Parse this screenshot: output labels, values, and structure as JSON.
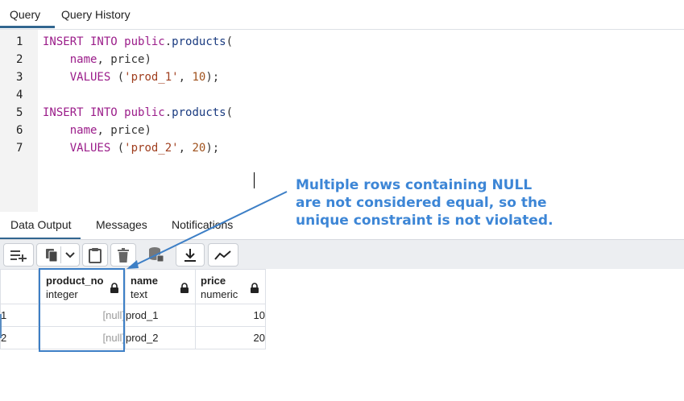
{
  "top_tabs": [
    {
      "label": "Query",
      "active": true
    },
    {
      "label": "Query History",
      "active": false
    }
  ],
  "editor": {
    "lines": [
      {
        "num": "1",
        "tokens": [
          [
            "kw",
            "INSERT INTO "
          ],
          [
            "kw",
            "public"
          ],
          [
            "pun",
            "."
          ],
          [
            "nm",
            "products"
          ],
          [
            "pun",
            "("
          ]
        ]
      },
      {
        "num": "2",
        "tokens": [
          [
            "pun",
            "    "
          ],
          [
            "kw",
            "name"
          ],
          [
            "pun",
            ", "
          ],
          [
            "id",
            "price"
          ],
          [
            "pun",
            ")"
          ]
        ]
      },
      {
        "num": "3",
        "tokens": [
          [
            "pun",
            "    "
          ],
          [
            "kw",
            "VALUES"
          ],
          [
            "pun",
            " ("
          ],
          [
            "str",
            "'prod_1'"
          ],
          [
            "pun",
            ", "
          ],
          [
            "num",
            "10"
          ],
          [
            "pun",
            ");"
          ]
        ]
      },
      {
        "num": "4",
        "tokens": []
      },
      {
        "num": "5",
        "tokens": [
          [
            "kw",
            "INSERT INTO "
          ],
          [
            "kw",
            "public"
          ],
          [
            "pun",
            "."
          ],
          [
            "nm",
            "products"
          ],
          [
            "pun",
            "("
          ]
        ]
      },
      {
        "num": "6",
        "tokens": [
          [
            "pun",
            "    "
          ],
          [
            "kw",
            "name"
          ],
          [
            "pun",
            ", "
          ],
          [
            "id",
            "price"
          ],
          [
            "pun",
            ")"
          ]
        ]
      },
      {
        "num": "7",
        "tokens": [
          [
            "pun",
            "    "
          ],
          [
            "kw",
            "VALUES"
          ],
          [
            "pun",
            " ("
          ],
          [
            "str",
            "'prod_2'"
          ],
          [
            "pun",
            ", "
          ],
          [
            "num",
            "20"
          ],
          [
            "pun",
            ");"
          ]
        ]
      }
    ]
  },
  "bottom_tabs": [
    {
      "label": "Data Output",
      "active": true
    },
    {
      "label": "Messages",
      "active": false
    },
    {
      "label": "Notifications",
      "active": false
    }
  ],
  "toolbar": {
    "buttons": [
      "add-row-icon",
      "copy-icon",
      "dropdown-chevron-icon",
      "paste-icon",
      "delete-icon",
      "save-data-icon",
      "download-icon",
      "graph-visualiser-icon"
    ]
  },
  "grid": {
    "columns": [
      {
        "name": "product_no",
        "type": "integer",
        "locked": true
      },
      {
        "name": "name",
        "type": "text",
        "locked": true
      },
      {
        "name": "price",
        "type": "numeric",
        "locked": true
      }
    ],
    "rows": [
      {
        "index": "1",
        "product_no": "[null]",
        "name": "prod_1",
        "price": "10"
      },
      {
        "index": "2",
        "product_no": "[null]",
        "name": "prod_2",
        "price": "20"
      }
    ]
  },
  "annotation": {
    "lines": [
      "Multiple rows containing NULL",
      "are not considered equal, so the",
      "unique constraint is not violated."
    ],
    "color": "#3d86d6"
  }
}
